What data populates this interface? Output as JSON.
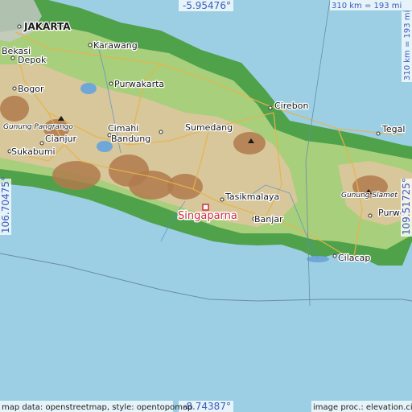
{
  "coordinates": {
    "north": "-5.95476°",
    "south": "-8.74387°",
    "west": "106.70475°",
    "east": "109.51725°"
  },
  "scale": {
    "top": "310 km = 193 mi",
    "right": "310 km = 193 mi"
  },
  "credits": {
    "left": "map data: openstreetmap, style: opentopomap",
    "right": "image proc.: elevation.city"
  },
  "target_city": "Singaparna",
  "cities": {
    "jakarta": "JAKARTA",
    "bekasi": "Bekasi",
    "depok": "Depok",
    "karawang": "Karawang",
    "bogor": "Bogor",
    "purwakarta": "Purwakarta",
    "cirebon": "Cirebon",
    "tegal": "Tegal",
    "cimahi": "Cimahi",
    "bandung": "Bandung",
    "sumedang": "Sumedang",
    "cianjur": "Cianjur",
    "sukabumi": "Sukabumi",
    "tasikmalaya": "Tasikmalaya",
    "banjar": "Banjar",
    "cilacap": "Cilacap",
    "purwokerto": "Purwo"
  },
  "peaks": {
    "pangrango": "Gunung Pangrango",
    "slamet": "Gunung Slamet"
  },
  "colors": {
    "sea": "#9ccfe4",
    "lowland": "#4fa24a",
    "hills": "#a8cf7c",
    "highland": "#d8c79a",
    "mountain": "#b07a4c",
    "target": "#c8303c",
    "coordinate_text": "#3a5bbf"
  }
}
